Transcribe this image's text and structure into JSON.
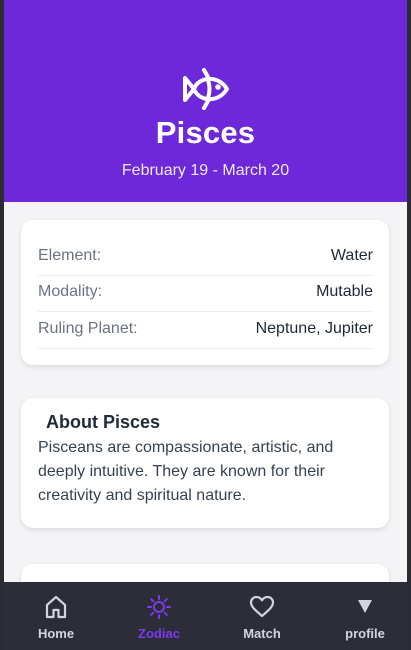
{
  "sign": {
    "icon": "fish-icon",
    "name": "Pisces",
    "dates": "February 19 - March 20"
  },
  "traits": [
    {
      "label": "Element:",
      "value": "Water"
    },
    {
      "label": "Modality:",
      "value": "Mutable"
    },
    {
      "label": "Ruling Planet:",
      "value": "Neptune, Jupiter"
    }
  ],
  "about": {
    "title": "About Pisces",
    "text": "Pisceans are compassionate, artistic, and deeply intuitive. They are known for their creativity and spiritual nature."
  },
  "nav": {
    "items": [
      {
        "label": "Home",
        "icon": "home-icon",
        "active": false
      },
      {
        "label": "Zodiac",
        "icon": "sun-icon",
        "active": true
      },
      {
        "label": "Match",
        "icon": "heart-icon",
        "active": false
      },
      {
        "label": "profile",
        "icon": "triangle-down-icon",
        "active": false
      }
    ]
  },
  "colors": {
    "hero_background": "#6d28d9",
    "active_nav": "#7c3aed",
    "nav_background": "#2d2d3a"
  }
}
